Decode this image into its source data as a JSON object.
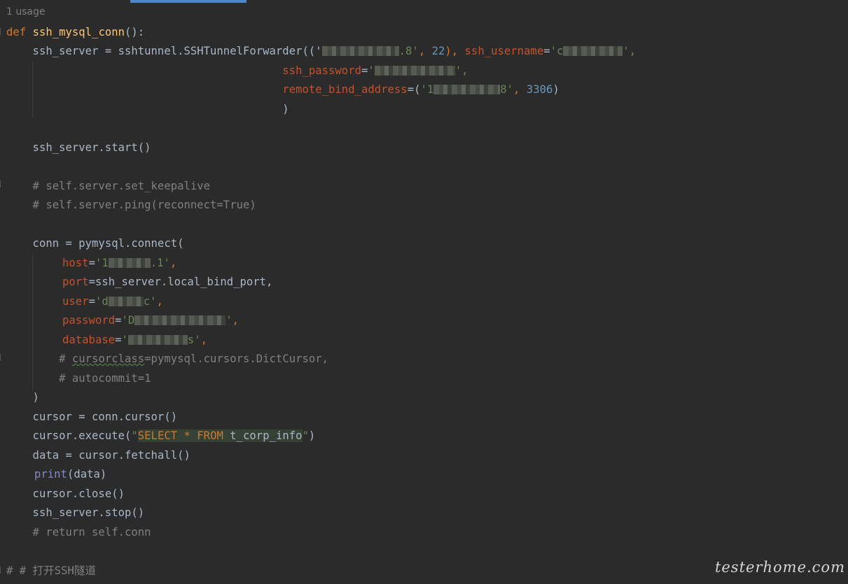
{
  "editor": {
    "usage_hint": "1 usage",
    "watermark": "testerhome.com"
  },
  "code": {
    "def_kw": "def",
    "func_name": "ssh_mysql_conn",
    "func_tail": "():",
    "l2_a": "    ssh_server = sshtunnel.SSHTunnelForwarder(('",
    "l2_b": ".8'",
    "l2_c": ", ",
    "l2_num": "22",
    "l2_d": "), ",
    "l2_param": "ssh_username",
    "l2_e": "=",
    "l2_str": "'c",
    "l2_f": "',",
    "l3_indent": "                                          ",
    "l3_param": "ssh_password",
    "l3_eq": "=",
    "l3_str_open": "'",
    "l3_str_close": "',",
    "l4_indent": "                                          ",
    "l4_param": "remote_bind_address",
    "l4_a": "=(",
    "l4_str_open": "'1",
    "l4_str_close": "8'",
    "l4_b": ", ",
    "l4_num": "3306",
    "l4_c": ")",
    "l5": "                                          )",
    "l7": "    ssh_server.start()",
    "l9": "    # self.server.set_keepalive",
    "l10": "    # self.server.ping(reconnect=True)",
    "l12": "    conn = pymysql.connect(",
    "l13_param": "host",
    "l13_eq": "=",
    "l13_str_open": "'1",
    "l13_str_close": ".1'",
    "l13_comma": ",",
    "l14_param": "port",
    "l14_rest": "=ssh_server.local_bind_port,",
    "l15_param": "user",
    "l15_eq": "=",
    "l15_str_open": "'d",
    "l15_str_close": "c'",
    "l15_comma": ",",
    "l16_param": "password",
    "l16_eq": "=",
    "l16_str_open": "'D",
    "l16_str_close": "'",
    "l16_comma": ",",
    "l17_param": "database",
    "l17_eq": "=",
    "l17_str_open": "'",
    "l17_str_close": "s'",
    "l17_comma": ",",
    "l18_a": "        # ",
    "l18_sq": "cursorclass",
    "l18_b": "=pymysql.cursors.DictCursor,",
    "l19": "        # autocommit=1",
    "l20": "    )",
    "l21": "    cursor = conn.cursor()",
    "l22_a": "    cursor.execute(",
    "l22_q1": "\"",
    "l22_sel": "SELECT",
    "l22_star": " * ",
    "l22_from": "FROM",
    "l22_tbl": " t_corp_info",
    "l22_q2": "\"",
    "l22_b": ")",
    "l23": "    data = cursor.fetchall()",
    "l24_builtin": "print",
    "l24_rest": "(data)",
    "l25": "    cursor.close()",
    "l26": "    ssh_server.stop()",
    "l27": "    # return self.conn",
    "l29": "# # 打开SSH隧道"
  },
  "colors": {
    "background": "#2b2b2b",
    "keyword": "#cc7832",
    "function": "#ffc66d",
    "string": "#6a8759",
    "number": "#6897bb",
    "parameter": "#aa4926",
    "comment": "#808080",
    "builtin": "#8888c6",
    "text": "#a9b7c6"
  }
}
